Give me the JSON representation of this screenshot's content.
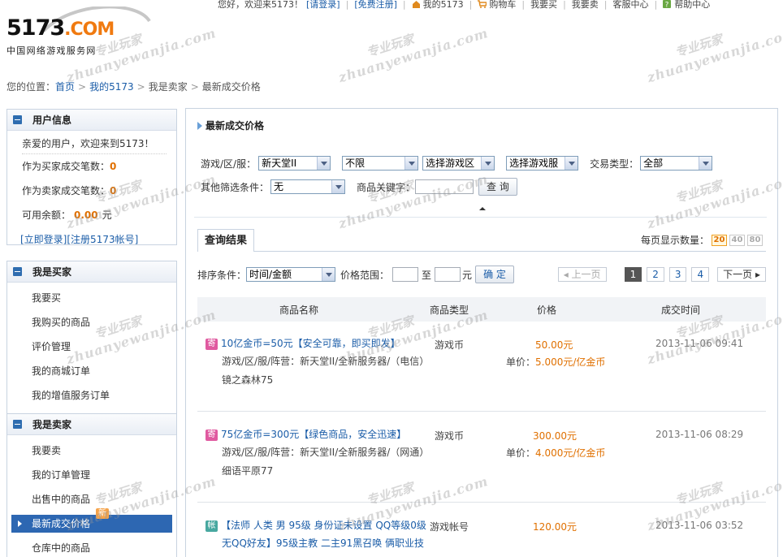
{
  "topbar": {
    "greeting": "您好，欢迎来5173！",
    "login": "[请登录]",
    "register": "[免费注册]",
    "my5173": "我的5173",
    "cart": "购物车",
    "buy": "我要买",
    "sell": "我要卖",
    "service": "客服中心",
    "help": "帮助中心"
  },
  "logo": {
    "main_digits": "5173",
    "main_suffix": ".COM",
    "subtitle": "中国网络游戏服务网"
  },
  "breadcrumb": {
    "label": "您的位置：",
    "home": "首页",
    "my": "我的5173",
    "seller": "我是卖家",
    "current": "最新成交价格"
  },
  "user_info": {
    "title": "用户信息",
    "welcome": "亲爱的用户，欢迎来到5173！",
    "buyer_count_label": "作为买家成交笔数：",
    "buyer_count": "0",
    "seller_count_label": "作为卖家成交笔数：",
    "seller_count": "0",
    "balance_label": "可用余额：",
    "balance": "0.00",
    "balance_unit": "元",
    "login_link": "[立即登录]",
    "register_link": "[注册5173帐号]"
  },
  "buyer_menu": {
    "title": "我是买家",
    "items": [
      "我要买",
      "我购买的商品",
      "评价管理",
      "我的商城订单",
      "我的增值服务订单"
    ]
  },
  "seller_menu": {
    "title": "我是卖家",
    "items": [
      "我要卖",
      "我的订单管理",
      "出售中的商品",
      "最新成交价格",
      "仓库中的商品"
    ],
    "new_badge": "新"
  },
  "main": {
    "title": "最新成交价格",
    "filters": {
      "game_label": "游戏/区/服：",
      "game": "新天堂II",
      "area": "不限",
      "zone": "选择游戏区",
      "server": "选择游戏服",
      "trade_type_label": "交易类型：",
      "trade_type": "全部",
      "other_label": "其他筛选条件：",
      "other": "无",
      "keyword_label": "商品关键字：",
      "keyword": "",
      "search_button": "查 询"
    },
    "results_tab": "查询结果",
    "per_page_label": "每页显示数量：",
    "per_page_options": [
      "20",
      "40",
      "80"
    ],
    "sort_label": "排序条件：",
    "sort": "时间/金额",
    "price_range_label": "价格范围：",
    "to": "至",
    "unit": "元",
    "confirm_button": "确 定",
    "pager": {
      "prev": "上一页",
      "pages": [
        "1",
        "2",
        "3",
        "4"
      ],
      "next": "下一页"
    },
    "columns": [
      "商品名称",
      "商品类型",
      "价格",
      "成交时间"
    ],
    "rows": [
      {
        "tag": "寄",
        "title": "10亿金币=50元【安全可靠，即买即发】",
        "server": "游戏/区/服/阵营：新天堂II/全新服务器/（电信）",
        "extra": "镜之森林75",
        "type": "游戏币",
        "price": "50.00元",
        "unit_label": "单价：",
        "unit_price": "5.000元/亿金币",
        "time": "2013-11-06 09:41"
      },
      {
        "tag": "寄",
        "title": "75亿金币=300元【绿色商品，安全迅速】",
        "server": "游戏/区/服/阵营：新天堂II/全新服务器/（网通）",
        "extra": "细语平原77",
        "type": "游戏币",
        "price": "300.00元",
        "unit_label": "单价：",
        "unit_price": "4.000元/亿金币",
        "time": "2013-11-06 08:29"
      },
      {
        "tag": "帐",
        "title": "【法师 人类 男 95级 身份证未设置 QQ等级0级",
        "title2": "无QQ好友】95级主教 二主91黑召唤 俩职业技",
        "type": "游戏帐号",
        "price": "120.00元",
        "time": "2013-11-06 03:52"
      }
    ]
  },
  "watermark": {
    "line1": "专业玩家",
    "line2": "zhuanyewanjia.com"
  }
}
